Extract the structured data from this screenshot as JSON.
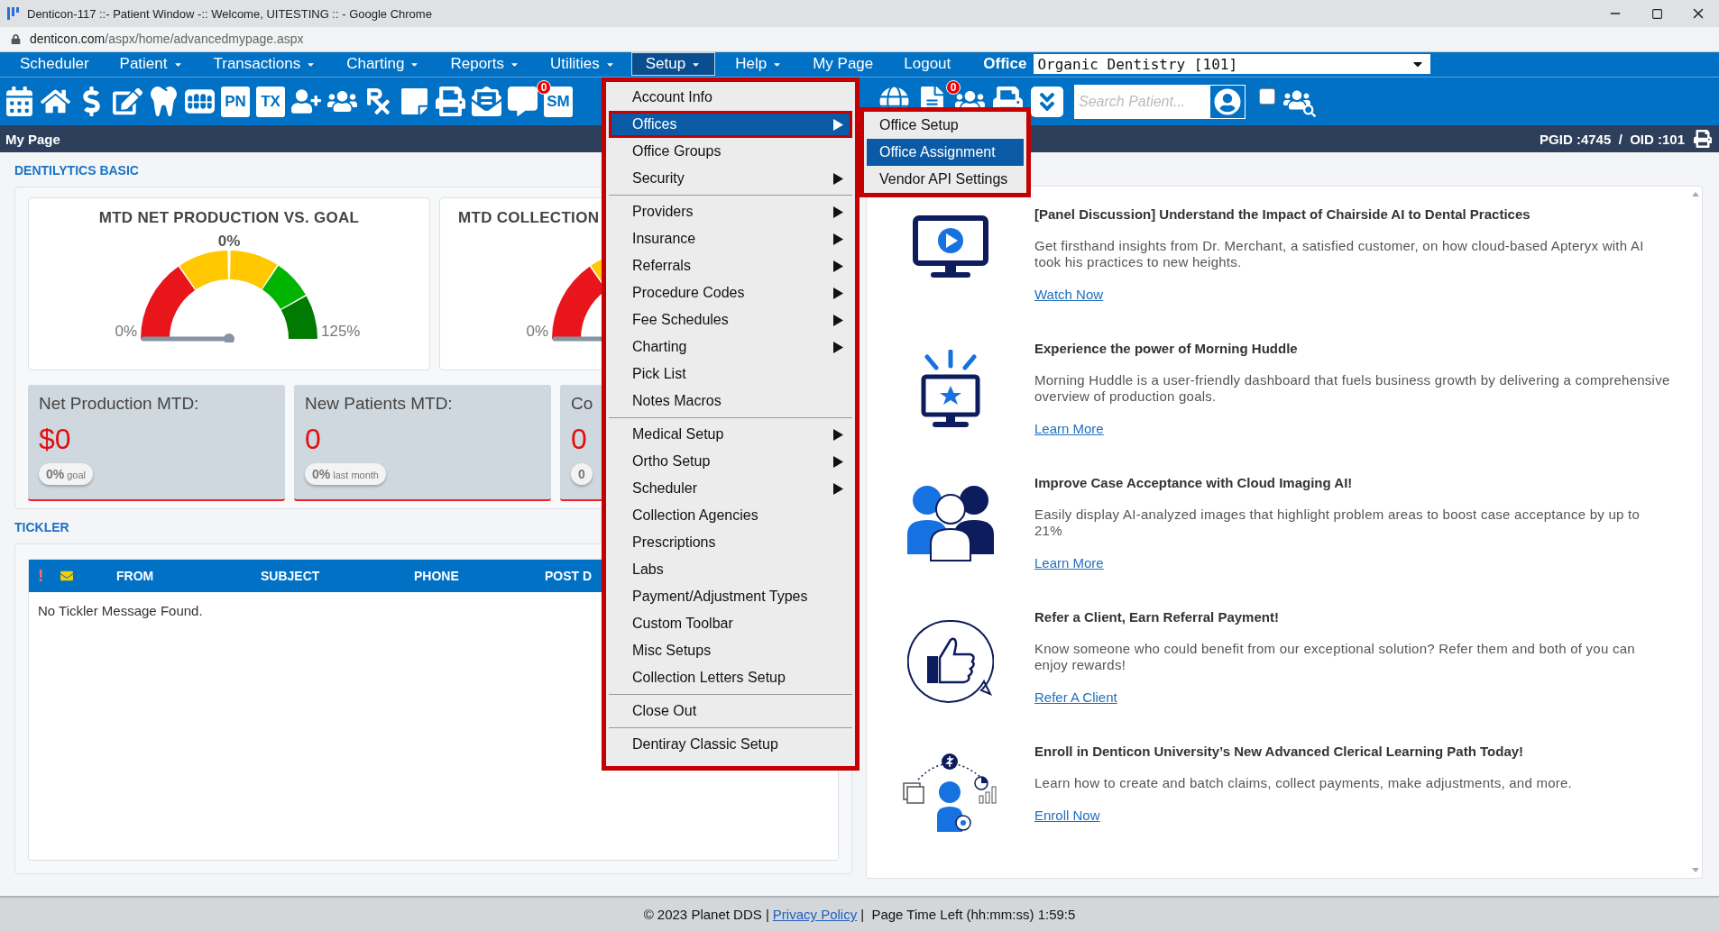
{
  "window": {
    "title": "Denticon-117 ::- Patient Window -:: Welcome, UITESTING :: - Google Chrome",
    "url_domain": "denticon.com",
    "url_path": "/aspx/home/advancedmypage.aspx"
  },
  "menu_bar": {
    "items": [
      {
        "label": "Scheduler",
        "dropdown": false,
        "selected": false
      },
      {
        "label": "Patient",
        "dropdown": true,
        "selected": false
      },
      {
        "label": "Transactions",
        "dropdown": true,
        "selected": false
      },
      {
        "label": "Charting",
        "dropdown": true,
        "selected": false
      },
      {
        "label": "Reports",
        "dropdown": true,
        "selected": false
      },
      {
        "label": "Utilities",
        "dropdown": true,
        "selected": false
      },
      {
        "label": "Setup",
        "dropdown": true,
        "selected": true
      },
      {
        "label": "Help",
        "dropdown": true,
        "selected": false
      },
      {
        "label": "My Page",
        "dropdown": false,
        "selected": false
      },
      {
        "label": "Logout",
        "dropdown": false,
        "selected": false
      }
    ],
    "office_label": "Office",
    "office_value": "Organic Dentistry [101]"
  },
  "toolbar": {
    "pn_label": "PN",
    "tx_label": "TX",
    "message_badge": "0",
    "sms_label": "SM",
    "document_badge": "0",
    "search_placeholder": "Search Patient...",
    "checkbox_checked": false
  },
  "page_bar": {
    "title": "My Page",
    "ids": "PGID :4745  /  OID :101"
  },
  "dentilytics": {
    "title": "DENTILYTICS BASIC",
    "gauges": [
      {
        "title": "MTD NET PRODUCTION VS. GOAL",
        "value": "0%",
        "min": "0%",
        "max": "125%",
        "level": 0
      },
      {
        "title": "MTD COLLECTION",
        "min": "0%",
        "level": 0
      }
    ],
    "stats": [
      {
        "label": "Net Production MTD:",
        "value": "$0",
        "badge_value": "0%",
        "badge_label": "goal"
      },
      {
        "label": "New Patients MTD:",
        "value": "0",
        "badge_value": "0%",
        "badge_label": "last month"
      },
      {
        "label": "Co",
        "value": "0",
        "badge_value": "0"
      }
    ]
  },
  "tickler": {
    "title": "TICKLER",
    "priority_mark": "!",
    "columns": [
      "FROM",
      "SUBJECT",
      "PHONE",
      "POST D"
    ],
    "empty_message": "No Tickler Message Found."
  },
  "setup_menu": {
    "groups": [
      [
        {
          "label": "Account Info",
          "submenu": false,
          "selected": false
        },
        {
          "label": "Offices",
          "submenu": true,
          "selected": true
        },
        {
          "label": "Office Groups",
          "submenu": false,
          "selected": false
        },
        {
          "label": "Security",
          "submenu": true,
          "selected": false
        }
      ],
      [
        {
          "label": "Providers",
          "submenu": true,
          "selected": false
        },
        {
          "label": "Insurance",
          "submenu": true,
          "selected": false
        },
        {
          "label": "Referrals",
          "submenu": true,
          "selected": false
        },
        {
          "label": "Procedure Codes",
          "submenu": true,
          "selected": false
        },
        {
          "label": "Fee Schedules",
          "submenu": true,
          "selected": false
        },
        {
          "label": "Charting",
          "submenu": true,
          "selected": false
        },
        {
          "label": "Pick List",
          "submenu": false,
          "selected": false
        },
        {
          "label": "Notes Macros",
          "submenu": false,
          "selected": false
        }
      ],
      [
        {
          "label": "Medical Setup",
          "submenu": true,
          "selected": false
        },
        {
          "label": "Ortho Setup",
          "submenu": true,
          "selected": false
        },
        {
          "label": "Scheduler",
          "submenu": true,
          "selected": false
        },
        {
          "label": "Collection Agencies",
          "submenu": false,
          "selected": false
        },
        {
          "label": "Prescriptions",
          "submenu": false,
          "selected": false
        },
        {
          "label": "Labs",
          "submenu": false,
          "selected": false
        },
        {
          "label": "Payment/Adjustment Types",
          "submenu": false,
          "selected": false
        },
        {
          "label": "Custom Toolbar",
          "submenu": false,
          "selected": false
        },
        {
          "label": "Misc Setups",
          "submenu": false,
          "selected": false
        },
        {
          "label": "Collection Letters Setup",
          "submenu": false,
          "selected": false
        }
      ],
      [
        {
          "label": "Close Out",
          "submenu": false,
          "selected": false
        }
      ],
      [
        {
          "label": "Dentiray Classic Setup",
          "submenu": false,
          "selected": false
        }
      ]
    ],
    "submenu": [
      {
        "label": "Office Setup",
        "selected": false
      },
      {
        "label": "Office Assignment",
        "selected": true
      },
      {
        "label": "Vendor API Settings",
        "selected": false
      }
    ]
  },
  "articles": [
    {
      "kind": "video",
      "title": "[Panel Discussion] Understand the Impact of Chairside AI to Dental Practices",
      "body": "Get firsthand insights from Dr. Merchant, a satisfied customer, on how cloud-based Apteryx with AI took his practices to new heights.",
      "link": "Watch Now"
    },
    {
      "kind": "dashboard",
      "title": "Experience the power of Morning Huddle",
      "body": "Morning Huddle is a user-friendly dashboard that fuels business growth by delivering a comprehensive overview of production goals.",
      "link": "Learn More"
    },
    {
      "kind": "imaging",
      "title": "Improve Case Acceptance with Cloud Imaging AI!",
      "body": "Easily display AI-analyzed images that highlight problem areas to boost case acceptance by up to 21%",
      "link": "Learn More"
    },
    {
      "kind": "referral",
      "title": "Refer a Client, Earn Referral Payment!",
      "body": "Know someone who could benefit from our exceptional solution? Refer them and both of you can enjoy rewards!",
      "link": "Refer A Client"
    },
    {
      "kind": "learning",
      "title": "Enroll in Denticon University’s New Advanced Clerical Learning Path Today!",
      "body": "Learn how to create and batch claims, collect payments, make adjustments, and more.",
      "link": "Enroll Now"
    }
  ],
  "footer": {
    "copyright": "© 2023 Planet DDS |",
    "link": "Privacy Policy",
    "timer": "|  Page Time Left (hh:mm:ss) 1:59:5"
  }
}
